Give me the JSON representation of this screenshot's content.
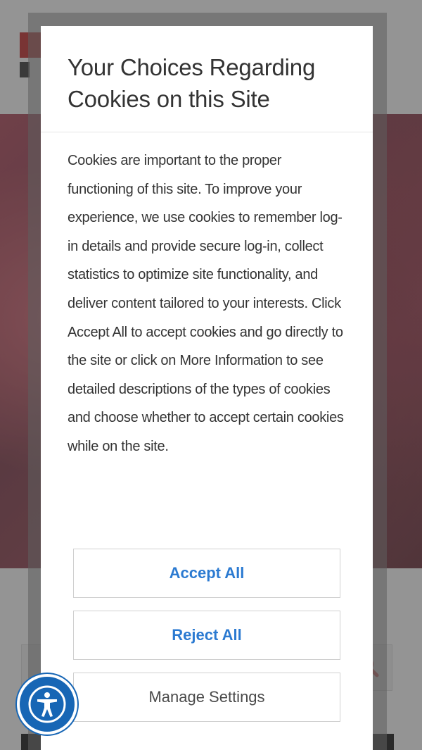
{
  "dialog": {
    "title": "Your Choices Regarding Cookies on this Site",
    "body": "Cookies are important to the proper functioning of this site. To improve your experience, we use cookies to remember log-in details and provide secure log-in, collect statistics to optimize site functionality, and deliver content tailored to your interests. Click Accept All to accept cookies and go directly to the site or click on More Information to see detailed descriptions of the types of cookies and choose whether to accept certain cookies while on the site.",
    "buttons": {
      "accept_all": "Accept All",
      "reject_all": "Reject All",
      "manage_settings": "Manage Settings"
    }
  },
  "icons": {
    "accessibility": "accessibility-icon",
    "search": "search-icon"
  },
  "colors": {
    "button_accent": "#2b7ad1",
    "accessibility_bg": "#1766b5",
    "brand_red": "#7a1010"
  }
}
